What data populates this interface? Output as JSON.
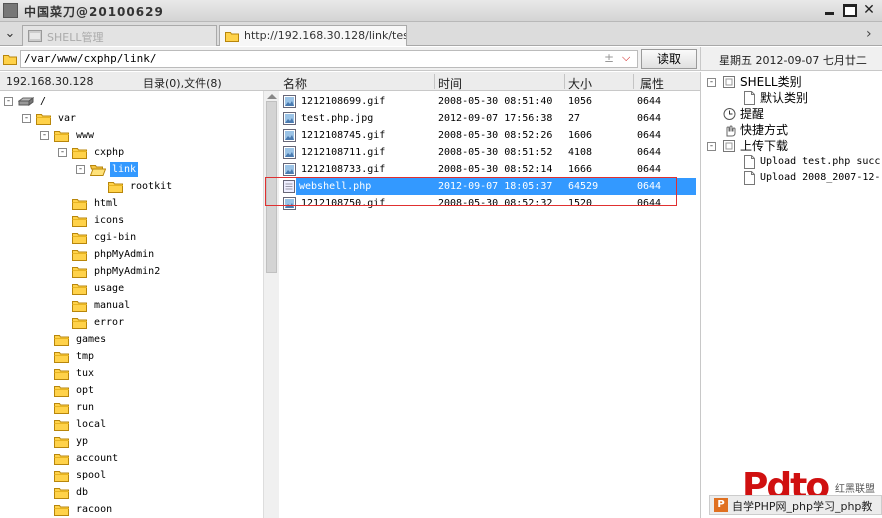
{
  "window": {
    "title": "中国菜刀@20100629"
  },
  "tabs": [
    {
      "label": "SHELL管理",
      "active": false
    },
    {
      "label": "http://192.168.30.128/link/test....",
      "active": true
    }
  ],
  "path_bar": {
    "path": "/var/www/cxphp/link/",
    "read_label": "读取"
  },
  "date_label": "星期五 2012-09-07 七月廿二",
  "left_header": {
    "ip": "192.168.30.128",
    "count": "目录(0),文件(8)"
  },
  "tree": [
    {
      "label": "/",
      "depth": 0,
      "exp": "-",
      "icon": "drive-icon"
    },
    {
      "label": "var",
      "depth": 1,
      "exp": "-"
    },
    {
      "label": "www",
      "depth": 2,
      "exp": "-"
    },
    {
      "label": "cxphp",
      "depth": 3,
      "exp": "-"
    },
    {
      "label": "link",
      "depth": 4,
      "exp": "-",
      "selected": true,
      "open": true
    },
    {
      "label": "rootkit",
      "depth": 5
    },
    {
      "label": "html",
      "depth": 3
    },
    {
      "label": "icons",
      "depth": 3
    },
    {
      "label": "cgi-bin",
      "depth": 3
    },
    {
      "label": "phpMyAdmin",
      "depth": 3
    },
    {
      "label": "phpMyAdmin2",
      "depth": 3
    },
    {
      "label": "usage",
      "depth": 3
    },
    {
      "label": "manual",
      "depth": 3
    },
    {
      "label": "error",
      "depth": 3
    },
    {
      "label": "games",
      "depth": 2
    },
    {
      "label": "tmp",
      "depth": 2
    },
    {
      "label": "tux",
      "depth": 2
    },
    {
      "label": "opt",
      "depth": 2
    },
    {
      "label": "run",
      "depth": 2
    },
    {
      "label": "local",
      "depth": 2
    },
    {
      "label": "yp",
      "depth": 2
    },
    {
      "label": "account",
      "depth": 2
    },
    {
      "label": "spool",
      "depth": 2
    },
    {
      "label": "db",
      "depth": 2
    },
    {
      "label": "racoon",
      "depth": 2
    }
  ],
  "file_columns": {
    "name": "名称",
    "time": "时间",
    "size": "大小",
    "attr": "属性"
  },
  "files": [
    {
      "name": "1212108699.gif",
      "time": "2008-05-30 08:51:40",
      "size": "1056",
      "attr": "0644"
    },
    {
      "name": "test.php.jpg",
      "time": "2012-09-07 17:56:38",
      "size": "27",
      "attr": "0644"
    },
    {
      "name": "1212108745.gif",
      "time": "2008-05-30 08:52:26",
      "size": "1606",
      "attr": "0644"
    },
    {
      "name": "1212108711.gif",
      "time": "2008-05-30 08:51:52",
      "size": "4108",
      "attr": "0644"
    },
    {
      "name": "1212108733.gif",
      "time": "2008-05-30 08:52:14",
      "size": "1666",
      "attr": "0644"
    },
    {
      "name": "webshell.php",
      "time": "2012-09-07 18:05:37",
      "size": "64529",
      "attr": "0644",
      "selected": true
    },
    {
      "name": "1212108750.gif",
      "time": "2008-05-30 08:52:32",
      "size": "1520",
      "attr": "0644"
    }
  ],
  "right_tree": [
    {
      "label": "SHELL类别",
      "depth": 0,
      "exp": "-",
      "icon": "box"
    },
    {
      "label": "默认类别",
      "depth": 1,
      "icon": "page"
    },
    {
      "label": "提醒",
      "depth": 0,
      "icon": "clock"
    },
    {
      "label": "快捷方式",
      "depth": 0,
      "icon": "hand"
    },
    {
      "label": "上传下载",
      "depth": 0,
      "exp": "-",
      "icon": "box"
    },
    {
      "label": "Upload test.php succ",
      "depth": 1,
      "icon": "page",
      "mono": true
    },
    {
      "label": "Upload 2008_2007-12-",
      "depth": 1,
      "icon": "page",
      "mono": true
    }
  ],
  "watermark": {
    "logo": "Pdto",
    "side": "红黑联盟",
    "bar": "自学PHP网_php学习_php教"
  }
}
